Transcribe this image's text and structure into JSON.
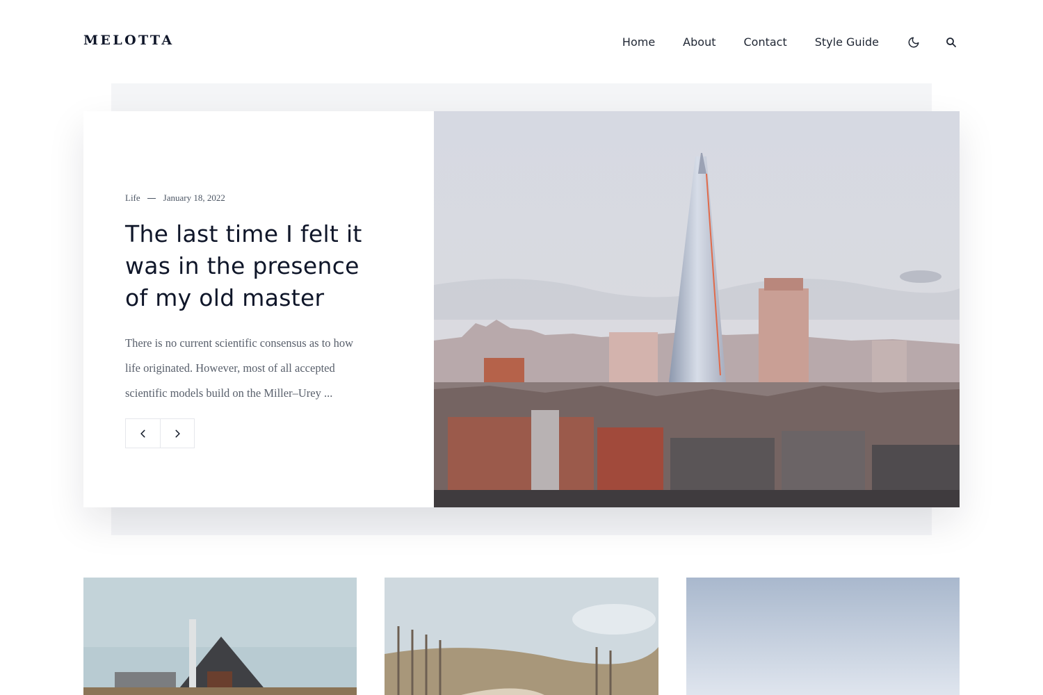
{
  "site": {
    "logo": "MELOTTA"
  },
  "nav": {
    "items": [
      {
        "label": "Home"
      },
      {
        "label": "About"
      },
      {
        "label": "Contact"
      },
      {
        "label": "Style Guide"
      }
    ],
    "icons": [
      "moon-icon",
      "search-icon"
    ]
  },
  "featured": {
    "category": "Life",
    "date": "January 18, 2022",
    "title_lines": [
      "The last time I felt it",
      "was in the presence",
      "of my old master"
    ],
    "excerpt_lines": [
      "There is no current scientific consensus as to how",
      "life originated. However, most of all accepted",
      "scientific models build on the Miller–Urey ..."
    ],
    "prev_icon": "chevron-left-icon",
    "next_icon": "chevron-right-icon",
    "image": "london-skyline-photo"
  },
  "cards": [
    {
      "image": "wooden-house-photo"
    },
    {
      "image": "beach-fence-dunes-photo"
    },
    {
      "image": "pale-sky-photo"
    }
  ],
  "colors": {
    "text": "#0f1629",
    "muted": "#585f6b",
    "panel": "#f4f5f7"
  }
}
